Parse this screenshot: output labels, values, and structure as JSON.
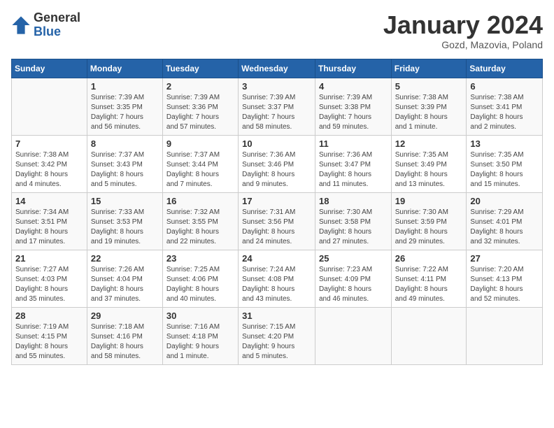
{
  "logo": {
    "general": "General",
    "blue": "Blue"
  },
  "header": {
    "month": "January 2024",
    "location": "Gozd, Mazovia, Poland"
  },
  "weekdays": [
    "Sunday",
    "Monday",
    "Tuesday",
    "Wednesday",
    "Thursday",
    "Friday",
    "Saturday"
  ],
  "weeks": [
    [
      {
        "day": "",
        "info": ""
      },
      {
        "day": "1",
        "info": "Sunrise: 7:39 AM\nSunset: 3:35 PM\nDaylight: 7 hours\nand 56 minutes."
      },
      {
        "day": "2",
        "info": "Sunrise: 7:39 AM\nSunset: 3:36 PM\nDaylight: 7 hours\nand 57 minutes."
      },
      {
        "day": "3",
        "info": "Sunrise: 7:39 AM\nSunset: 3:37 PM\nDaylight: 7 hours\nand 58 minutes."
      },
      {
        "day": "4",
        "info": "Sunrise: 7:39 AM\nSunset: 3:38 PM\nDaylight: 7 hours\nand 59 minutes."
      },
      {
        "day": "5",
        "info": "Sunrise: 7:38 AM\nSunset: 3:39 PM\nDaylight: 8 hours\nand 1 minute."
      },
      {
        "day": "6",
        "info": "Sunrise: 7:38 AM\nSunset: 3:41 PM\nDaylight: 8 hours\nand 2 minutes."
      }
    ],
    [
      {
        "day": "7",
        "info": "Sunrise: 7:38 AM\nSunset: 3:42 PM\nDaylight: 8 hours\nand 4 minutes."
      },
      {
        "day": "8",
        "info": "Sunrise: 7:37 AM\nSunset: 3:43 PM\nDaylight: 8 hours\nand 5 minutes."
      },
      {
        "day": "9",
        "info": "Sunrise: 7:37 AM\nSunset: 3:44 PM\nDaylight: 8 hours\nand 7 minutes."
      },
      {
        "day": "10",
        "info": "Sunrise: 7:36 AM\nSunset: 3:46 PM\nDaylight: 8 hours\nand 9 minutes."
      },
      {
        "day": "11",
        "info": "Sunrise: 7:36 AM\nSunset: 3:47 PM\nDaylight: 8 hours\nand 11 minutes."
      },
      {
        "day": "12",
        "info": "Sunrise: 7:35 AM\nSunset: 3:49 PM\nDaylight: 8 hours\nand 13 minutes."
      },
      {
        "day": "13",
        "info": "Sunrise: 7:35 AM\nSunset: 3:50 PM\nDaylight: 8 hours\nand 15 minutes."
      }
    ],
    [
      {
        "day": "14",
        "info": "Sunrise: 7:34 AM\nSunset: 3:51 PM\nDaylight: 8 hours\nand 17 minutes."
      },
      {
        "day": "15",
        "info": "Sunrise: 7:33 AM\nSunset: 3:53 PM\nDaylight: 8 hours\nand 19 minutes."
      },
      {
        "day": "16",
        "info": "Sunrise: 7:32 AM\nSunset: 3:55 PM\nDaylight: 8 hours\nand 22 minutes."
      },
      {
        "day": "17",
        "info": "Sunrise: 7:31 AM\nSunset: 3:56 PM\nDaylight: 8 hours\nand 24 minutes."
      },
      {
        "day": "18",
        "info": "Sunrise: 7:30 AM\nSunset: 3:58 PM\nDaylight: 8 hours\nand 27 minutes."
      },
      {
        "day": "19",
        "info": "Sunrise: 7:30 AM\nSunset: 3:59 PM\nDaylight: 8 hours\nand 29 minutes."
      },
      {
        "day": "20",
        "info": "Sunrise: 7:29 AM\nSunset: 4:01 PM\nDaylight: 8 hours\nand 32 minutes."
      }
    ],
    [
      {
        "day": "21",
        "info": "Sunrise: 7:27 AM\nSunset: 4:03 PM\nDaylight: 8 hours\nand 35 minutes."
      },
      {
        "day": "22",
        "info": "Sunrise: 7:26 AM\nSunset: 4:04 PM\nDaylight: 8 hours\nand 37 minutes."
      },
      {
        "day": "23",
        "info": "Sunrise: 7:25 AM\nSunset: 4:06 PM\nDaylight: 8 hours\nand 40 minutes."
      },
      {
        "day": "24",
        "info": "Sunrise: 7:24 AM\nSunset: 4:08 PM\nDaylight: 8 hours\nand 43 minutes."
      },
      {
        "day": "25",
        "info": "Sunrise: 7:23 AM\nSunset: 4:09 PM\nDaylight: 8 hours\nand 46 minutes."
      },
      {
        "day": "26",
        "info": "Sunrise: 7:22 AM\nSunset: 4:11 PM\nDaylight: 8 hours\nand 49 minutes."
      },
      {
        "day": "27",
        "info": "Sunrise: 7:20 AM\nSunset: 4:13 PM\nDaylight: 8 hours\nand 52 minutes."
      }
    ],
    [
      {
        "day": "28",
        "info": "Sunrise: 7:19 AM\nSunset: 4:15 PM\nDaylight: 8 hours\nand 55 minutes."
      },
      {
        "day": "29",
        "info": "Sunrise: 7:18 AM\nSunset: 4:16 PM\nDaylight: 8 hours\nand 58 minutes."
      },
      {
        "day": "30",
        "info": "Sunrise: 7:16 AM\nSunset: 4:18 PM\nDaylight: 9 hours\nand 1 minute."
      },
      {
        "day": "31",
        "info": "Sunrise: 7:15 AM\nSunset: 4:20 PM\nDaylight: 9 hours\nand 5 minutes."
      },
      {
        "day": "",
        "info": ""
      },
      {
        "day": "",
        "info": ""
      },
      {
        "day": "",
        "info": ""
      }
    ]
  ]
}
